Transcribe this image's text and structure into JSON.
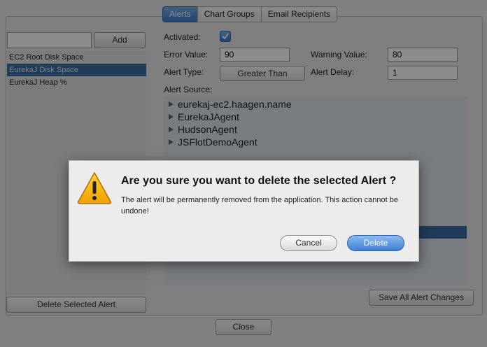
{
  "tabs": [
    {
      "label": "Alerts",
      "active": true
    },
    {
      "label": "Chart Groups",
      "active": false
    },
    {
      "label": "Email Recipients",
      "active": false
    }
  ],
  "left": {
    "new_alert_value": "",
    "add_label": "Add",
    "alerts": [
      {
        "label": "EC2 Root Disk Space",
        "selected": false
      },
      {
        "label": "EurekaJ Disk Space",
        "selected": true
      },
      {
        "label": "EurekaJ Heap %",
        "selected": false
      }
    ],
    "delete_label": "Delete Selected Alert"
  },
  "form": {
    "activated_label": "Activated:",
    "activated": true,
    "error_value_label": "Error Value:",
    "error_value": "90",
    "warning_value_label": "Warning Value:",
    "warning_value": "80",
    "alert_type_label": "Alert Type:",
    "alert_type": "Greater Than",
    "alert_delay_label": "Alert Delay:",
    "alert_delay": "1",
    "alert_source_label": "Alert Source:",
    "sources": [
      "eurekaj-ec2.haagen.name",
      "EurekaJAgent",
      "HudsonAgent",
      "JSFlotDemoAgent"
    ],
    "save_label": "Save All Alert Changes"
  },
  "close_label": "Close",
  "dialog": {
    "title": "Are you sure you want to delete the selected Alert ?",
    "message": "The alert will be permanently removed from the application. This action cannot be undone!",
    "cancel_label": "Cancel",
    "delete_label": "Delete"
  },
  "colors": {
    "accent": "#3d7fd3",
    "selection": "#3d6ea6"
  }
}
